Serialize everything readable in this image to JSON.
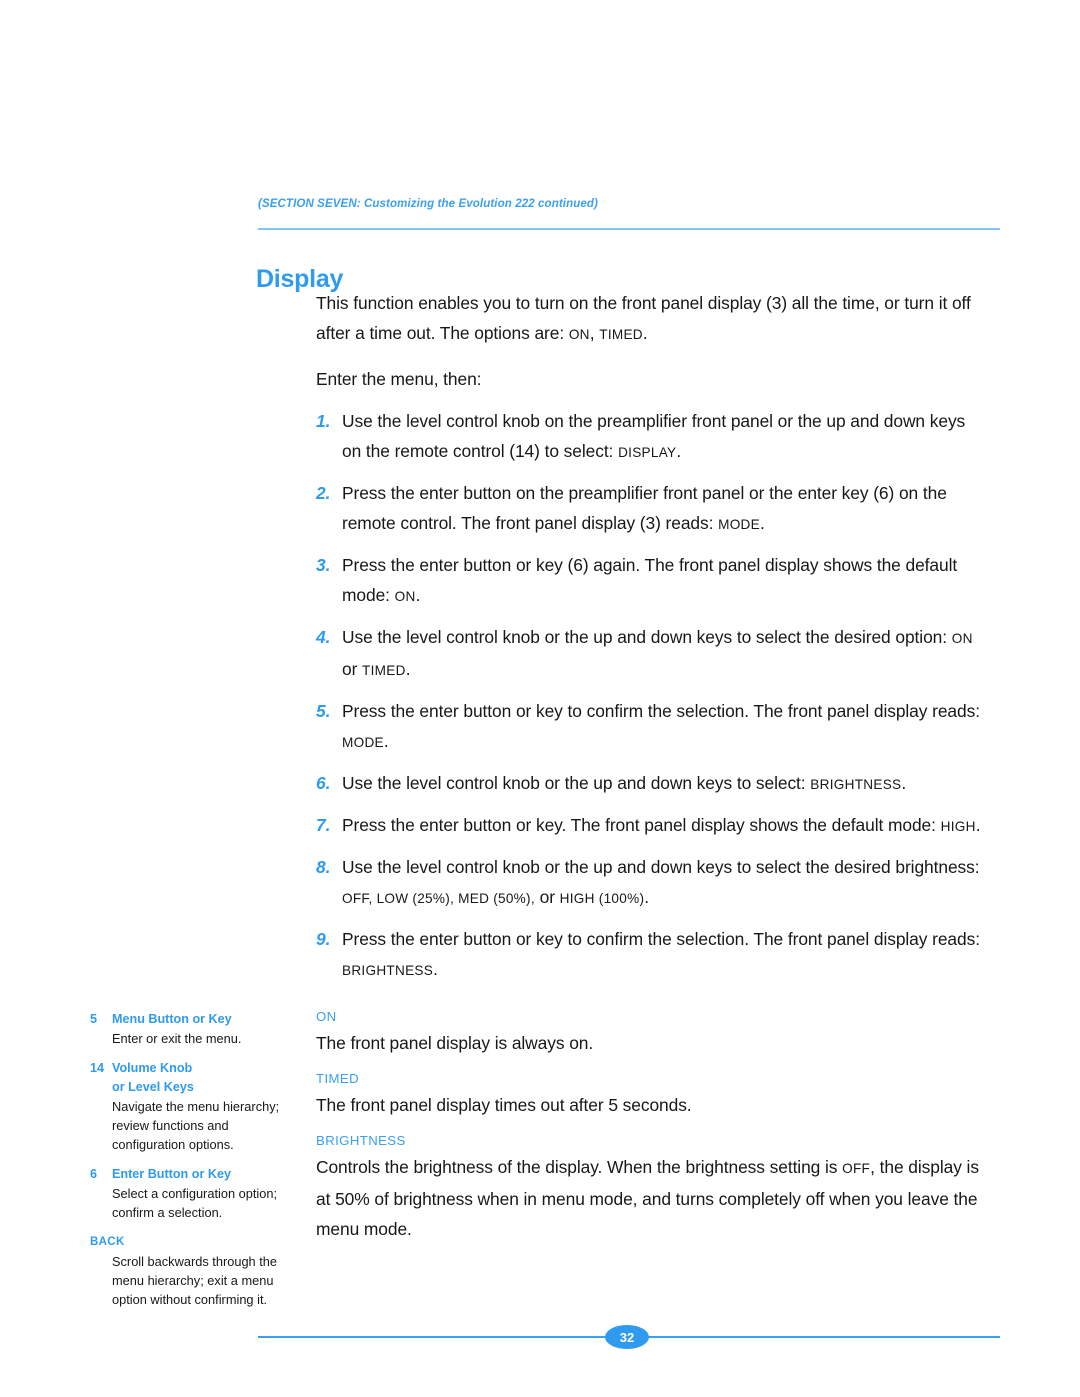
{
  "header": {
    "section_note": "(SECTION SEVEN: Customizing the Evolution 222 continued)"
  },
  "title": "Display",
  "colors": {
    "accent_blue": "#2e9bf0",
    "rule_blue": "#7ec8f7",
    "footer_blue": "#3aa0f2",
    "body_text": "#181818"
  },
  "intro": {
    "p1_a": "This function enables you to turn on the front panel display (3) all the time, or turn it off after a time out. The options are: ",
    "p1_sc1": "ON",
    "p1_b": ", ",
    "p1_sc2": "TIMED",
    "p1_c": ".",
    "p2": "Enter the menu, then:"
  },
  "steps": [
    {
      "num": "1.",
      "text_a": "Use the level control knob on the preamplifier front panel or the up and down keys on the remote control (14) to select: ",
      "sc": "DISPLAY",
      "text_b": "."
    },
    {
      "num": "2.",
      "text_a": "Press the enter button on the preamplifier front panel or the enter key (6) on the remote control. The front panel display (3) reads: ",
      "sc": "MODE",
      "text_b": "."
    },
    {
      "num": "3.",
      "text_a": "Press the enter button or key (6) again. The front panel display shows the default mode: ",
      "sc": "ON",
      "text_b": "."
    },
    {
      "num": "4.",
      "text_a": "Use the level control knob or the up and down keys to select the desired option: ",
      "sc": "ON",
      "text_b": " or ",
      "sc2": "TIMED",
      "text_c": "."
    },
    {
      "num": "5.",
      "text_a": "Press the enter button or key to confirm the selection. The front panel display reads: ",
      "sc": "MODE",
      "text_b": "."
    },
    {
      "num": "6.",
      "text_a": "Use the level control knob or the up and down keys to select: ",
      "sc": "BRIGHTNESS",
      "text_b": "."
    },
    {
      "num": "7.",
      "text_a": "Press the enter button or key. The front panel display shows the default mode: ",
      "sc": "HIGH",
      "text_b": "."
    },
    {
      "num": "8.",
      "text_a": "Use the level control knob or the up and down keys to select the desired brightness: ",
      "sc": "OFF, LOW (25%), MED (50%),",
      "text_b": " or ",
      "sc2": "HIGH (100%)",
      "text_c": "."
    },
    {
      "num": "9.",
      "text_a": "Press the enter button or key to confirm the selection. The front panel display reads: ",
      "sc": "BRIGHTNESS",
      "text_b": "."
    }
  ],
  "definitions": [
    {
      "heading": "ON",
      "body": "The front panel display is always on."
    },
    {
      "heading": "TIMED",
      "body": "The front panel display times out after 5 seconds."
    },
    {
      "heading": "BRIGHTNESS",
      "body_a": "Controls the brightness of the display. When the brightness setting is ",
      "body_sc": "OFF",
      "body_b": ", the display is at 50% of brightness when in menu mode, and turns completely off when you leave the menu mode."
    }
  ],
  "sidebar": [
    {
      "number": "5",
      "title": "Menu Button or Key",
      "body": "Enter or exit the menu."
    },
    {
      "number": "14",
      "title": "Volume Knob",
      "title2": "or Level Keys",
      "body": "Navigate the menu hierarchy; review functions and configuration options."
    },
    {
      "number": "6",
      "title": "Enter Button or Key",
      "body": "Select a configuration option; confirm a selection."
    },
    {
      "number": "",
      "title": "BACK",
      "body": "Scroll backwards through the menu hierarchy; exit a menu option without confirming it."
    }
  ],
  "footer": {
    "page_number": "32"
  }
}
